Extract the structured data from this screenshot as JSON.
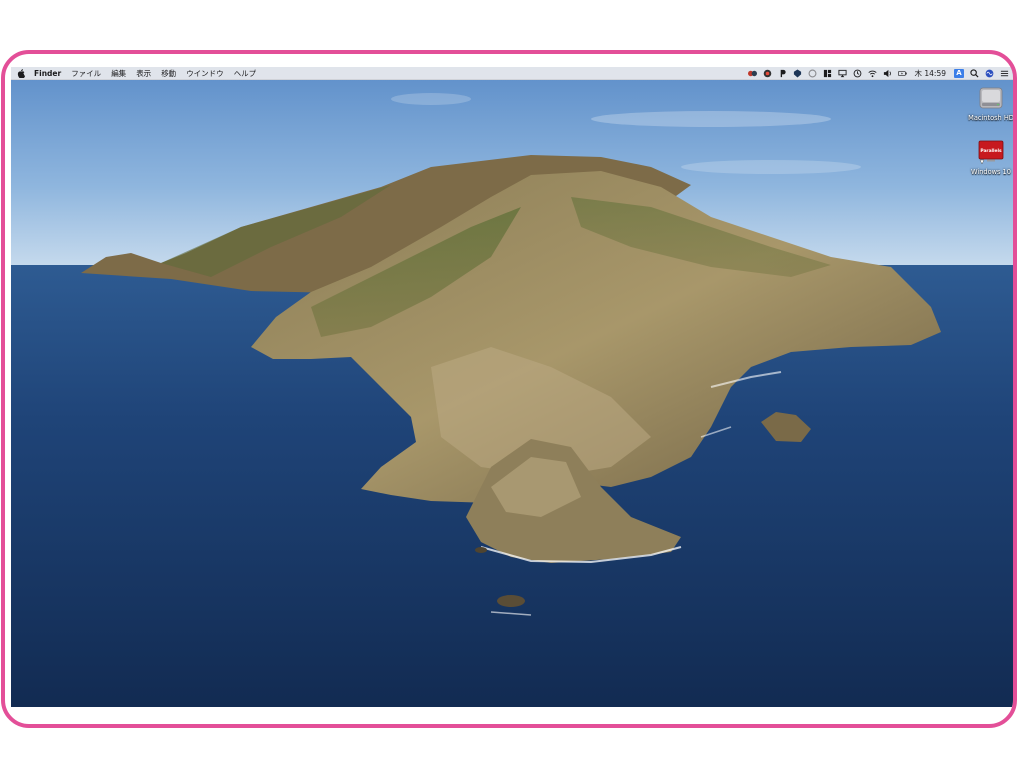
{
  "menubar": {
    "app_name": "Finder",
    "menus": [
      "ファイル",
      "編集",
      "表示",
      "移動",
      "ウインドウ",
      "ヘルプ"
    ],
    "clock": "木 14:59",
    "input_source": "A"
  },
  "desktop_icons": [
    {
      "label": "Macintosh HD",
      "icon": "hard-drive-icon"
    },
    {
      "label": "Windows 10",
      "icon": "parallels-vm-icon",
      "icon_text": "Parallels"
    }
  ],
  "colors": {
    "frame_border": "#e34f98",
    "sky_top": "#5d8ec9",
    "sea": "#1a3a6b",
    "input_badge": "#3b7ee8"
  }
}
